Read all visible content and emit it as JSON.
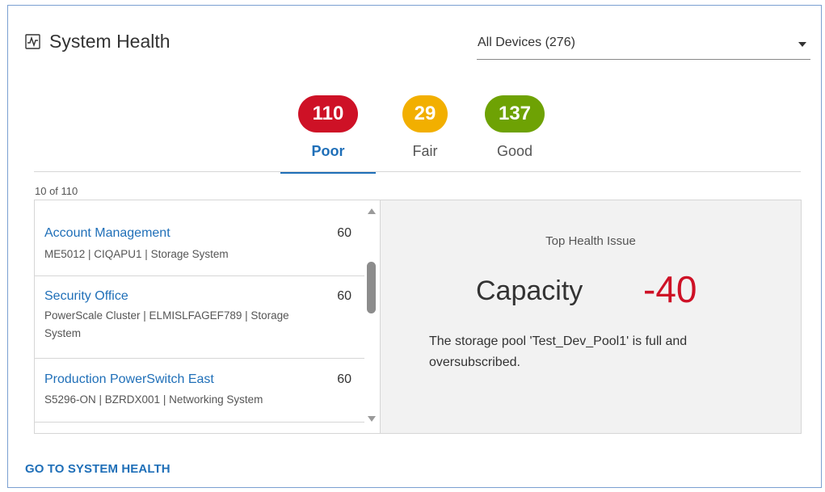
{
  "header": {
    "icon": "activity-chart-icon",
    "title": "System Health"
  },
  "device_filter": {
    "selected": "All Devices (276)",
    "icon": "caret-down-icon"
  },
  "tabs": [
    {
      "count": "110",
      "label": "Poor",
      "color": "#ce1126",
      "active": true
    },
    {
      "count": "29",
      "label": "Fair",
      "color": "#f2af00",
      "active": false
    },
    {
      "count": "137",
      "label": "Good",
      "color": "#6ea204",
      "active": false
    }
  ],
  "colors": {
    "accent": "#1f6fb8",
    "delta_negative": "#ce1126",
    "border": "#7a9fd1"
  },
  "list": {
    "count_text": "10 of 110",
    "items": [
      {
        "name": "Account Management",
        "score": "60",
        "meta": "ME5012 | CIQAPU1 | Storage System"
      },
      {
        "name": "Security Office",
        "score": "60",
        "meta": "PowerScale Cluster | ELMISLFAGEF789 | Storage System"
      },
      {
        "name": "Production PowerSwitch East",
        "score": "60",
        "meta": "S5296-ON | BZRDX001 | Networking System"
      }
    ]
  },
  "detail": {
    "title": "Top Health Issue",
    "category": "Capacity",
    "delta": "-40",
    "description": "The storage pool 'Test_Dev_Pool1' is full and oversubscribed."
  },
  "footer": {
    "link_label": "GO TO SYSTEM HEALTH"
  }
}
